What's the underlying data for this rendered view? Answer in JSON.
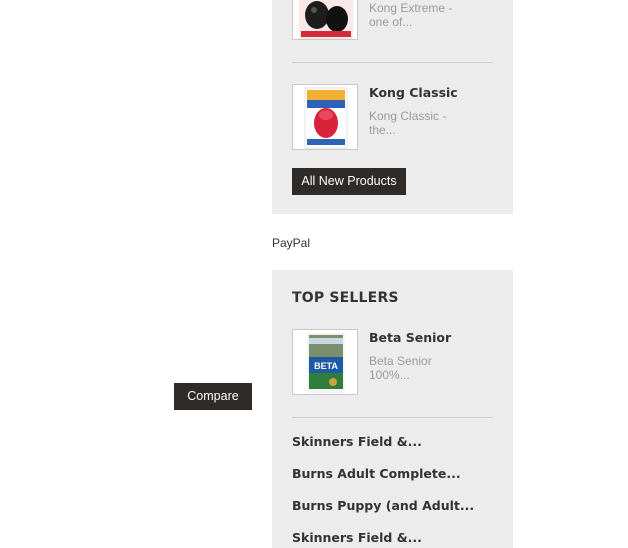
{
  "new_products": {
    "items": [
      {
        "name": "",
        "desc_line1": "Kong Extreme -",
        "desc_line2": "one of..."
      },
      {
        "name": "Kong Classic",
        "desc_line1": "Kong Classic -",
        "desc_line2": "the..."
      }
    ],
    "all_button": "All New Products"
  },
  "compare_button": "Compare",
  "paypal_label": "PayPal",
  "top_sellers": {
    "title": "TOP SELLERS",
    "featured": {
      "name": "Beta Senior",
      "desc_line1": "Beta Senior",
      "desc_line2": "100%..."
    },
    "links": [
      "Skinners Field &...",
      "Burns Adult Complete...",
      "Burns Puppy (and Adult...",
      "Skinners Field &..."
    ]
  },
  "colors": {
    "block_bg": "#ececec",
    "button_bg": "#2f2b29",
    "text": "#333333",
    "muted": "#9a9a9a"
  }
}
